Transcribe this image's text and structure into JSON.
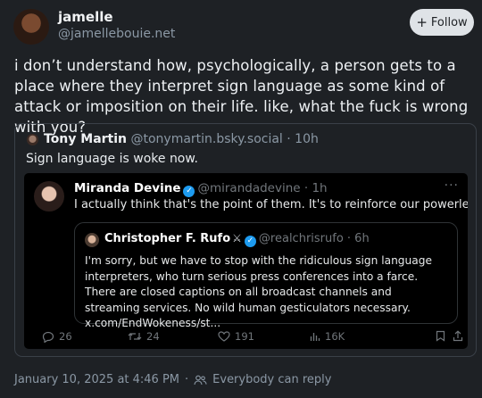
{
  "author": {
    "display_name": "jamelle",
    "handle": "@jamellebouie.net"
  },
  "follow_label": "Follow",
  "post_text": "i don’t understand how, psychologically, a person gets to a place where they interpret sign language as some kind of attack or imposition on their life. like, what the fuck is wrong with you?",
  "quote": {
    "author_name": "Tony Martin",
    "author_handle": "@tonymartin.bsky.social",
    "time": "· 10h",
    "text": "Sign language is woke now."
  },
  "embedded_tweet": {
    "author_name": "Miranda Devine",
    "author_handle": "@mirandadevine · 1h",
    "more": "···",
    "text": "I actually think that's the point of them. It's to reinforce our powerlessness.",
    "inner_tweet": {
      "author_name": "Christopher F. Rufo",
      "author_handle": "@realchrisrufo · 6h",
      "text": "I'm sorry, but we have to stop with the ridiculous sign language interpreters, who turn serious press conferences into a farce. There are closed captions on all broadcast channels and streaming services. No wild human gesticulators necessary. x.com/EndWokeness/st..."
    },
    "actions": {
      "replies": "26",
      "reposts": "24",
      "likes": "191",
      "views": "16K"
    }
  },
  "footer": {
    "timestamp": "January 10, 2025 at 4:46 PM",
    "reply_setting": "Everybody can reply"
  },
  "colors": {
    "background": "#1e2125",
    "verified": "#1d9bf0",
    "muted": "#8b98a5"
  }
}
